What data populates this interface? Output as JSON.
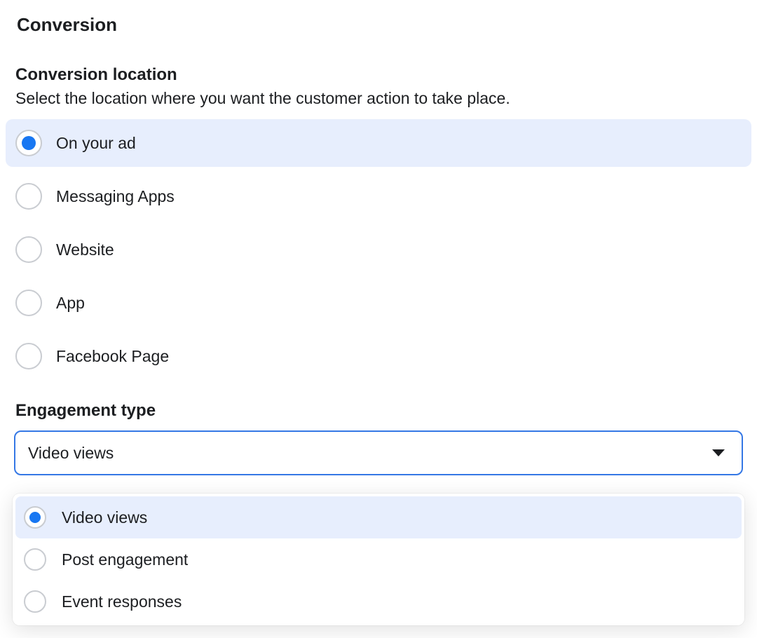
{
  "section": {
    "title": "Conversion"
  },
  "conversion_location": {
    "heading": "Conversion location",
    "description": "Select the location where you want the customer action to take place.",
    "options": [
      {
        "label": "On your ad",
        "selected": true
      },
      {
        "label": "Messaging Apps",
        "selected": false
      },
      {
        "label": "Website",
        "selected": false
      },
      {
        "label": "App",
        "selected": false
      },
      {
        "label": "Facebook Page",
        "selected": false
      }
    ]
  },
  "engagement_type": {
    "heading": "Engagement type",
    "selected_value": "Video views",
    "options": [
      {
        "label": "Video views",
        "selected": true
      },
      {
        "label": "Post engagement",
        "selected": false
      },
      {
        "label": "Event responses",
        "selected": false
      }
    ]
  }
}
